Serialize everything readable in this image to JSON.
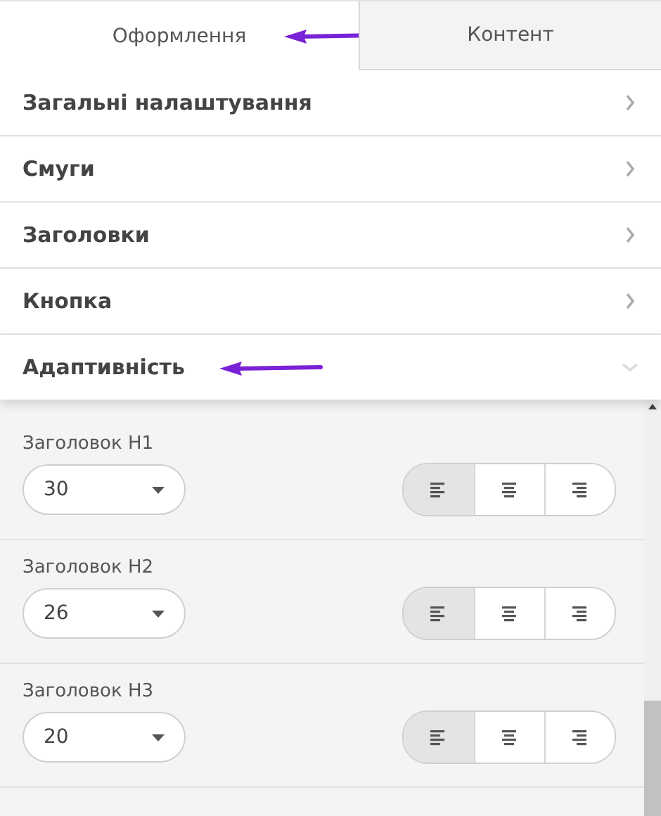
{
  "tabs": [
    {
      "label": "Оформлення",
      "selected": true
    },
    {
      "label": "Контент",
      "selected": false
    }
  ],
  "sections": [
    {
      "title": "Загальні налаштування",
      "expanded": false
    },
    {
      "title": "Смуги",
      "expanded": false
    },
    {
      "title": "Заголовки",
      "expanded": false
    },
    {
      "title": "Кнопка",
      "expanded": false
    },
    {
      "title": "Адаптивність",
      "expanded": true
    }
  ],
  "settings": [
    {
      "label": "Заголовок H1",
      "value": "30",
      "alignment": [
        {
          "kind": "left",
          "selected": true
        },
        {
          "kind": "center",
          "selected": false
        },
        {
          "kind": "right",
          "selected": false
        }
      ]
    },
    {
      "label": "Заголовок H2",
      "value": "26",
      "alignment": [
        {
          "kind": "left",
          "selected": true
        },
        {
          "kind": "center",
          "selected": false
        },
        {
          "kind": "right",
          "selected": false
        }
      ]
    },
    {
      "label": "Заголовок H3",
      "value": "20",
      "alignment": [
        {
          "kind": "left",
          "selected": true
        },
        {
          "kind": "center",
          "selected": false
        },
        {
          "kind": "right",
          "selected": false
        }
      ]
    }
  ]
}
